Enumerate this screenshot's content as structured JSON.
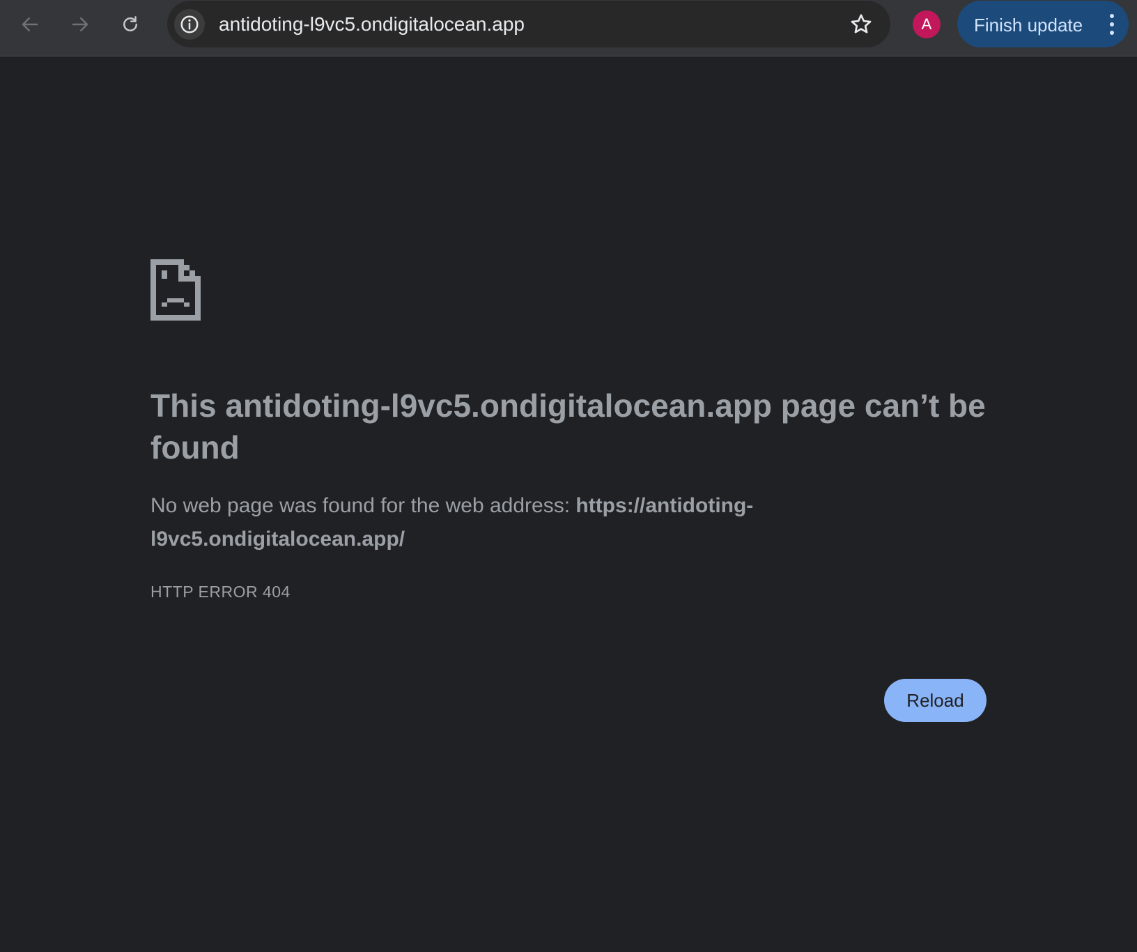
{
  "browser": {
    "url_display": "antidoting-l9vc5.ondigitalocean.app",
    "avatar_letter": "A",
    "update_label": "Finish update",
    "nav": {
      "back_icon": "arrow-left-icon",
      "forward_icon": "arrow-right-icon",
      "reload_icon": "refresh-icon"
    },
    "colors": {
      "toolbar": "#35363a",
      "omnibox": "#282828",
      "avatar": "#c2185b",
      "update_button": "#1c4a7a"
    }
  },
  "error_page": {
    "icon": "sad-page-icon",
    "heading": "This antidoting-l9vc5.ondigitalocean.app page can’t be found",
    "description_prefix": "No web page was found for the web address: ",
    "description_url": "https://antidoting-l9vc5.ondigitalocean.app/",
    "error_code": "HTTP ERROR 404",
    "reload_label": "Reload",
    "colors": {
      "background": "#202124",
      "text": "#9aa0a6",
      "reload_button": "#8ab4f8"
    }
  }
}
